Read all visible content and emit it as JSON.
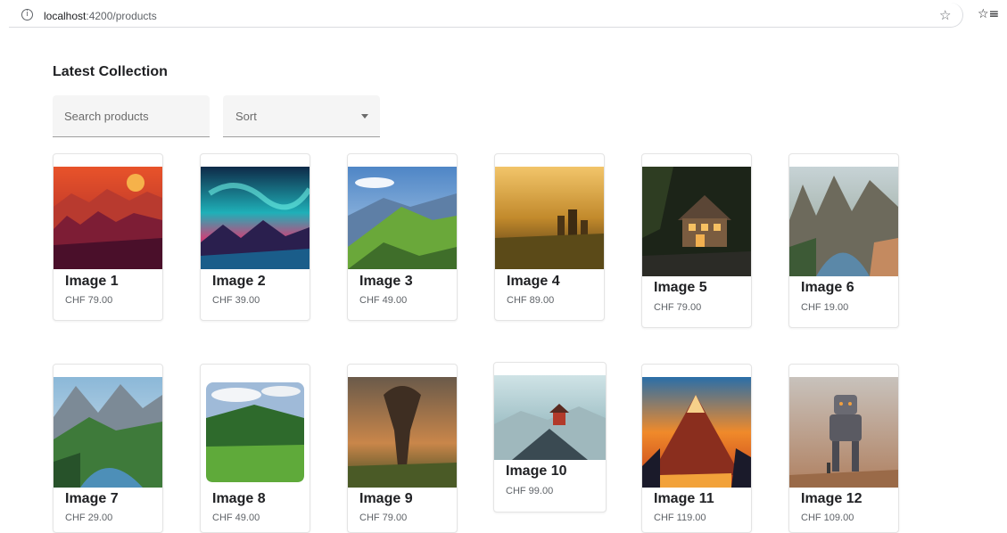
{
  "browser": {
    "url_host": "localhost",
    "url_path": ":4200/products"
  },
  "page": {
    "title": "Latest Collection"
  },
  "search": {
    "placeholder": "Search products"
  },
  "sort": {
    "label": "Sort"
  },
  "products": [
    {
      "title": "Image 1",
      "price": "CHF 79.00"
    },
    {
      "title": "Image 2",
      "price": "CHF 39.00"
    },
    {
      "title": "Image 3",
      "price": "CHF 49.00"
    },
    {
      "title": "Image 4",
      "price": "CHF 89.00"
    },
    {
      "title": "Image 5",
      "price": "CHF 79.00"
    },
    {
      "title": "Image 6",
      "price": "CHF 19.00"
    },
    {
      "title": "Image 7",
      "price": "CHF 29.00"
    },
    {
      "title": "Image 8",
      "price": "CHF 49.00"
    },
    {
      "title": "Image 9",
      "price": "CHF 79.00"
    },
    {
      "title": "Image 10",
      "price": "CHF 99.00"
    },
    {
      "title": "Image 11",
      "price": "CHF 119.00"
    },
    {
      "title": "Image 12",
      "price": "CHF 109.00"
    }
  ]
}
